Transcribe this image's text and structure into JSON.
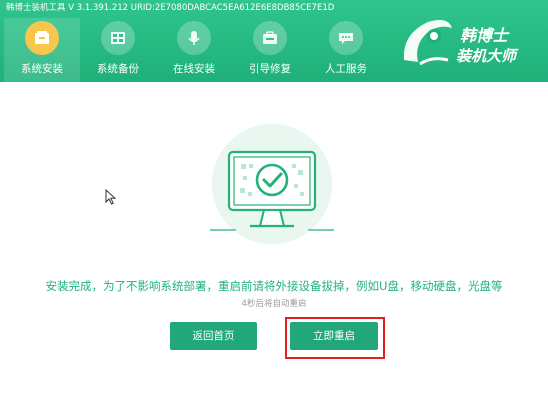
{
  "window": {
    "title": "韩博士装机工具 V 3.1.391.212 URID:2E7080DABCAC5EA612E6E8DB85CE7E1D"
  },
  "nav": {
    "items": [
      {
        "label": "系统安装",
        "icon": "install-icon",
        "active": true
      },
      {
        "label": "系统备份",
        "icon": "backup-icon",
        "active": false
      },
      {
        "label": "在线安装",
        "icon": "online-install-icon",
        "active": false
      },
      {
        "label": "引导修复",
        "icon": "boot-repair-icon",
        "active": false
      },
      {
        "label": "人工服务",
        "icon": "chat-service-icon",
        "active": false
      }
    ]
  },
  "brand": {
    "line1": "韩博士",
    "line2": "装机大师"
  },
  "main": {
    "message": "安装完成，为了不影响系统部署，重启前请将外接设备拔掉，例如U盘，移动硬盘，光盘等",
    "countdown": "4秒后将自动重启",
    "home_button": "返回首页",
    "restart_button": "立即重启"
  },
  "colors": {
    "header_green": "#1fb079",
    "accent_green": "#22a77a",
    "message_green": "#22b27a",
    "active_icon_yellow": "#f7c74b",
    "highlight_red": "#e0201e"
  }
}
